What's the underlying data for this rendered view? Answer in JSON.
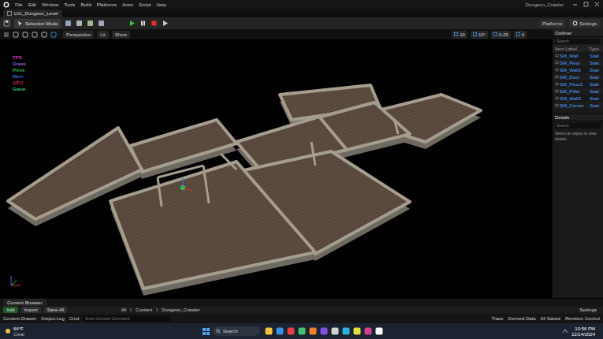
{
  "menu": {
    "items": [
      "File",
      "Edit",
      "Window",
      "Tools",
      "Build",
      "Platforms",
      "Actor",
      "Script",
      "Help"
    ]
  },
  "window": {
    "project": "Dungeon_Crawler",
    "level_tab": "LVL_Dungeon_Level"
  },
  "toolbar": {
    "mode": "Selection Mode",
    "platforms": "Platforms",
    "settings": "Settings"
  },
  "viewport_toolbar": {
    "perspective": "Perspective",
    "lit": "Lit",
    "show": "Show",
    "snap": "10",
    "angle": "10°",
    "scale": "0.25",
    "camera_speed": "4"
  },
  "stats": [
    {
      "label": "FPS",
      "color": "#ff55e8"
    },
    {
      "label": "Draws",
      "color": "#b070ff"
    },
    {
      "label": "Prims",
      "color": "#3ee06a"
    },
    {
      "label": "Mem",
      "color": "#4f86ff"
    },
    {
      "label": "GPU",
      "color": "#ff3f6a"
    },
    {
      "label": "Game",
      "color": "#3ee0a0"
    }
  ],
  "outliner": {
    "title": "Outliner",
    "search": "Search",
    "columns": [
      "Item Label",
      "Type"
    ],
    "rows": [
      {
        "label": "SM_Wall",
        "type": "Stati"
      },
      {
        "label": "SM_Floor",
        "type": "Stati"
      },
      {
        "label": "SM_Wall2",
        "type": "Stati"
      },
      {
        "label": "SM_Door",
        "type": "Stati"
      },
      {
        "label": "SM_Floor2",
        "type": "Stati"
      },
      {
        "label": "SM_Pillar",
        "type": "Stati"
      },
      {
        "label": "SM_Wall3",
        "type": "Stati"
      },
      {
        "label": "SM_Corner",
        "type": "Stati"
      }
    ]
  },
  "details": {
    "title": "Details",
    "search": "Search",
    "hint": "Select an object to view details."
  },
  "content": {
    "tab": "Content Browser",
    "buttons": [
      "Add",
      "Import",
      "Save All"
    ],
    "path": [
      "All",
      "Content",
      "Dungeon_Crawler"
    ],
    "settings": "Settings"
  },
  "status_bar": {
    "left": [
      "Content Drawer",
      "Output Log",
      "Cmd"
    ],
    "console_placeholder": "Enter Console Command",
    "right": [
      "Trace",
      "Derived Data",
      "All Saved",
      "Revision Control"
    ]
  },
  "taskbar": {
    "temperature": "64°F",
    "weather": "Clear",
    "search": "Search",
    "time": "10:56 PM",
    "date": "12/14/2024"
  }
}
